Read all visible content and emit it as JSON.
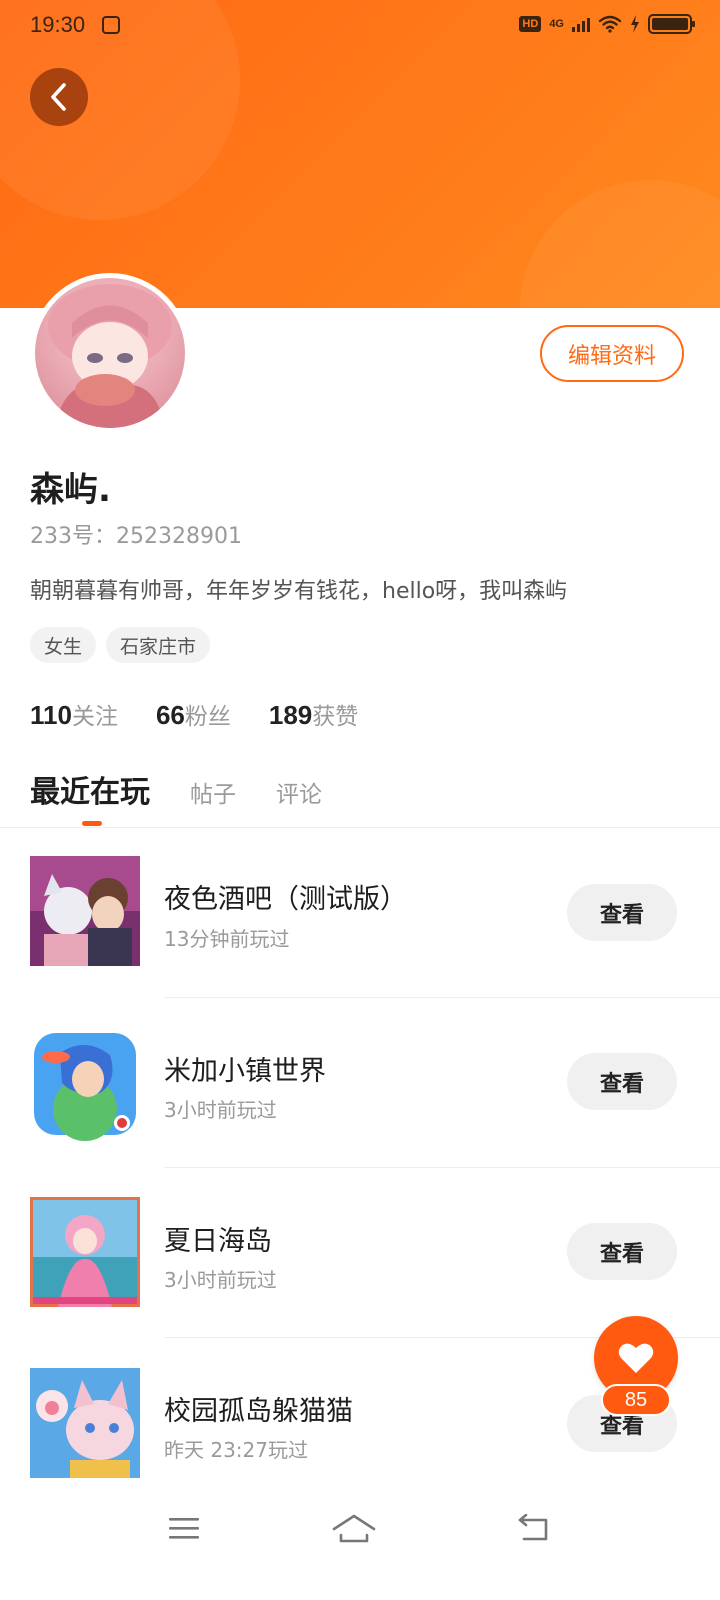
{
  "status_bar": {
    "time": "19:30",
    "hd": "HD",
    "network": "4G"
  },
  "profile": {
    "nickname": "森屿.",
    "uid": "233号：252328901",
    "bio": "朝朝暮暮有帅哥，年年岁岁有钱花，hello呀，我叫森屿",
    "tags": [
      "女生",
      "石家庄市"
    ],
    "edit_label": "编辑资料"
  },
  "stats": {
    "following": {
      "value": "110",
      "label": "关注"
    },
    "followers": {
      "value": "66",
      "label": "粉丝"
    },
    "likes": {
      "value": "189",
      "label": "获赞"
    }
  },
  "tabs": [
    "最近在玩",
    "帖子",
    "评论"
  ],
  "games": [
    {
      "title": "夜色酒吧（测试版）",
      "time": "13分钟前玩过",
      "button": "查看"
    },
    {
      "title": "米加小镇世界",
      "time": "3小时前玩过",
      "button": "查看"
    },
    {
      "title": "夏日海岛",
      "time": "3小时前玩过",
      "button": "查看"
    },
    {
      "title": "校园孤岛躲猫猫",
      "time": "昨天  23:27玩过",
      "button": "查看"
    }
  ],
  "like_fab": {
    "count": "85"
  },
  "colors": {
    "accent": "#ff6a13",
    "banner": "#ff7a1a"
  },
  "icons": {
    "back": "chevron-left-icon",
    "like": "heart-icon",
    "nav": [
      "menu-icon",
      "home-icon",
      "back-icon"
    ]
  }
}
